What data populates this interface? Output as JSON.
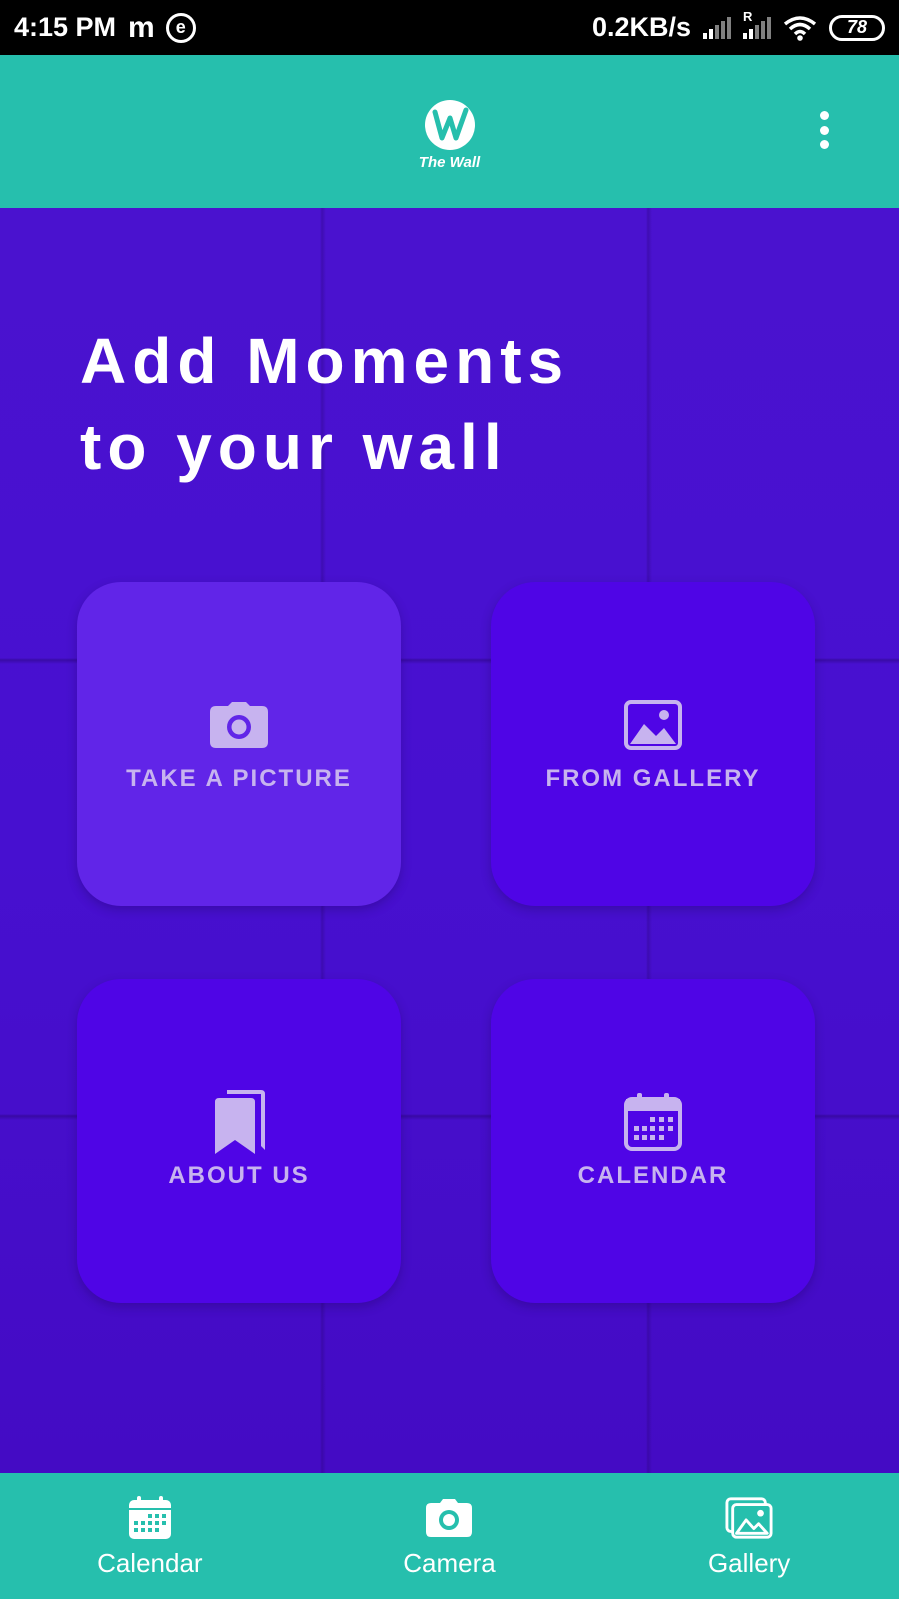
{
  "status_bar": {
    "time": "4:15 PM",
    "app_badge_m": "m",
    "app_badge_e": "e",
    "network_speed": "0.2KB/s",
    "roaming_label": "R",
    "battery": "78"
  },
  "app_bar": {
    "logo_name": "The Wall",
    "menu_icon": "more-vert-icon"
  },
  "main": {
    "headline_line1": "Add Moments",
    "headline_line2": "to your wall",
    "tiles": [
      {
        "label": "TAKE A PICTURE",
        "icon": "camera-icon"
      },
      {
        "label": "FROM GALLERY",
        "icon": "image-icon"
      },
      {
        "label": "ABOUT US",
        "icon": "bookmarks-icon"
      },
      {
        "label": "CALENDAR",
        "icon": "calendar-icon"
      }
    ]
  },
  "bottom_nav": {
    "items": [
      {
        "label": "Calendar",
        "icon": "calendar-icon"
      },
      {
        "label": "Camera",
        "icon": "camera-icon"
      },
      {
        "label": "Gallery",
        "icon": "gallery-icon"
      }
    ]
  },
  "colors": {
    "teal": "#26bfad",
    "purple_bg": "#4a12cf",
    "tile": "#4f05e6",
    "tile_active": "#6125e8",
    "tile_text": "#c7b3ef"
  }
}
